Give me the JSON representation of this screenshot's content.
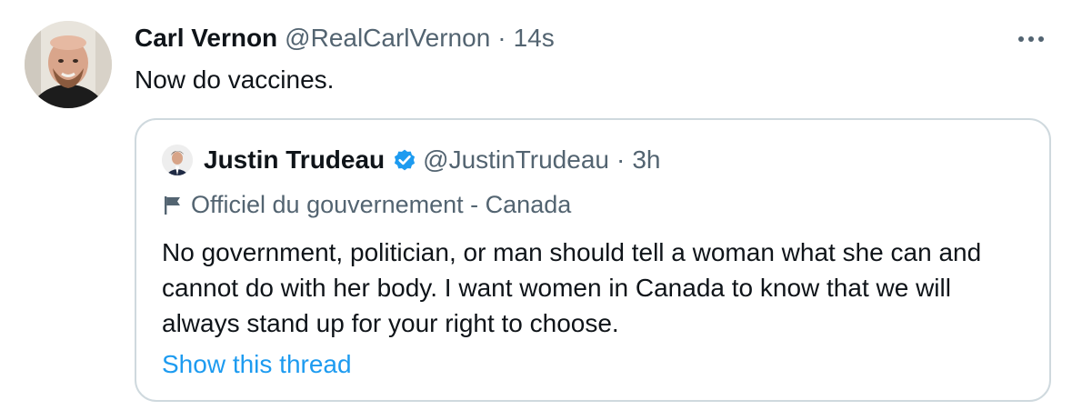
{
  "tweet": {
    "author_name": "Carl Vernon",
    "author_handle": "@RealCarlVernon",
    "separator": "·",
    "time": "14s",
    "text": "Now do vaccines.",
    "more_icon": "more-horizontal-icon"
  },
  "quote": {
    "author_name": "Justin Trudeau",
    "verified_icon": "verified-badge-icon",
    "author_handle": "@JustinTrudeau",
    "separator": "·",
    "time": "3h",
    "label_icon": "flag-icon",
    "label": "Officiel du gouvernement - Canada",
    "text": "No government, politician, or man should tell a woman what she can and cannot do with her body. I want women in Canada to know that we will always stand up for your right to choose.",
    "show_thread": "Show this thread"
  },
  "colors": {
    "text_primary": "#0f1419",
    "text_secondary": "#536471",
    "link": "#1d9bf0",
    "border": "#cfd9de",
    "verified": "#1d9bf0"
  }
}
